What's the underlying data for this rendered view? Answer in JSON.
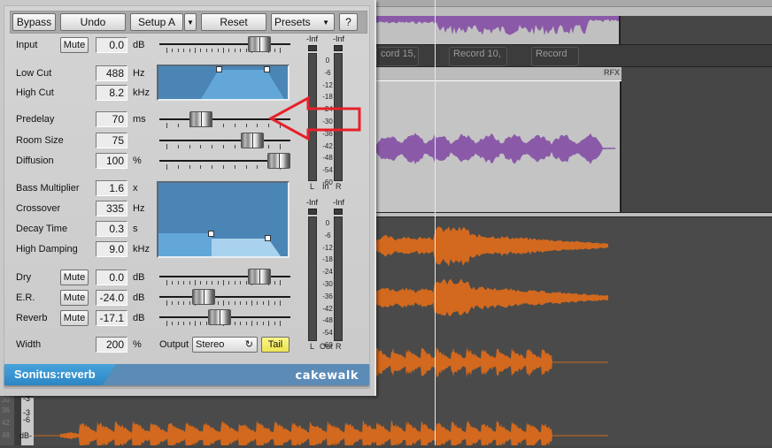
{
  "daw": {
    "clip_labels": [
      "cord 15,",
      "Record 10,",
      "Record"
    ],
    "fx_label": "RFX",
    "db_scale_left": [
      "30",
      "36",
      "42",
      "48"
    ],
    "db_labels": [
      "-3",
      "-3",
      "-6",
      "dB-"
    ]
  },
  "plugin": {
    "toolbar": {
      "bypass": "Bypass",
      "undo": "Undo",
      "setup": "Setup A",
      "setup_dropdown_icon": "▼",
      "reset": "Reset",
      "presets": "Presets",
      "presets_dropdown_icon": "▼",
      "help": "?"
    },
    "input": {
      "label": "Input",
      "mute": "Mute",
      "value": "0.0",
      "unit": "dB",
      "slider_fraction": 0.82
    },
    "low_cut": {
      "label": "Low Cut",
      "value": "488",
      "unit": "Hz"
    },
    "high_cut": {
      "label": "High Cut",
      "value": "8.2",
      "unit": "kHz"
    },
    "predelay": {
      "label": "Predelay",
      "value": "70",
      "unit": "ms",
      "slider_fraction": 0.28
    },
    "room_size": {
      "label": "Room Size",
      "value": "75",
      "unit": "",
      "slider_fraction": 0.75
    },
    "diffusion": {
      "label": "Diffusion",
      "value": "100",
      "unit": "%",
      "slider_fraction": 1.0
    },
    "bass_multiplier": {
      "label": "Bass Multiplier",
      "value": "1.6",
      "unit": "x"
    },
    "crossover": {
      "label": "Crossover",
      "value": "335",
      "unit": "Hz"
    },
    "decay_time": {
      "label": "Decay Time",
      "value": "0.3",
      "unit": "s"
    },
    "high_damping": {
      "label": "High Damping",
      "value": "9.0",
      "unit": "kHz"
    },
    "dry": {
      "label": "Dry",
      "mute": "Mute",
      "value": "0.0",
      "unit": "dB",
      "slider_fraction": 0.82
    },
    "er": {
      "label": "E.R.",
      "mute": "Mute",
      "value": "-24.0",
      "unit": "dB",
      "slider_fraction": 0.3
    },
    "reverb": {
      "label": "Reverb",
      "mute": "Mute",
      "value": "-17.1",
      "unit": "dB",
      "slider_fraction": 0.45
    },
    "width": {
      "label": "Width",
      "value": "200",
      "unit": "%"
    },
    "output": {
      "label": "Output",
      "value": "Stereo",
      "cycle_icon": "↻"
    },
    "tail": "Tail",
    "meters": {
      "in": {
        "left_peak": "-Inf",
        "right_peak": "-Inf",
        "left": "L",
        "center": "In",
        "right": "R"
      },
      "out": {
        "left_peak": "-Inf",
        "right_peak": "-Inf",
        "left": "L",
        "center": "Out",
        "right": "R"
      },
      "scale": [
        "0",
        "-6",
        "-12",
        "-18",
        "-24",
        "-30",
        "-36",
        "-42",
        "-48",
        "-54",
        "-60"
      ]
    },
    "brand": {
      "name": "Sonitus:reverb",
      "logo": "cakewalk"
    }
  },
  "colors": {
    "accent_blue": "#2c86c5",
    "waveform_orange": "#d2691e",
    "waveform_purple": "#8a5aa8",
    "tail_yellow": "#f2e65a",
    "annotation_red": "#e8202a"
  }
}
